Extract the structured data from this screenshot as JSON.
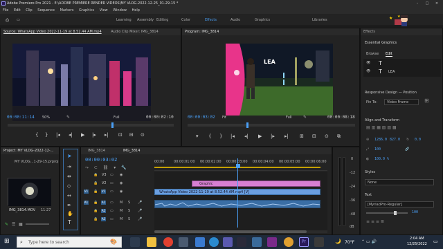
{
  "app": {
    "title": "Adobe Premiere Pro 2021 - E:\\ADOBE PREMIERE RENDER VIDEOS\\MY VLOG-2022-12-25_01-29-15 *"
  },
  "menu": [
    "File",
    "Edit",
    "Clip",
    "Sequence",
    "Markers",
    "Graphics",
    "View",
    "Window",
    "Help"
  ],
  "workspaces": [
    "Learning",
    "Assembly",
    "Editing",
    "Color",
    "Effects",
    "Audio",
    "Graphics",
    "Libraries"
  ],
  "active_workspace": "Effects",
  "source": {
    "tab": "Source: WhatsApp Video 2022-11-19 at 8.52.44 AM.mp4",
    "tab2": "Audio Clip Mixer: IMG_3814",
    "timecode": "00:00:11:14",
    "zoom": "50%",
    "quality": "Full",
    "duration": "00:00:02:10"
  },
  "program": {
    "tab": "Program: IMG_3814",
    "timecode": "00:00:03:02",
    "fit": "Fit",
    "quality": "Full",
    "duration": "00:00:08:18",
    "overlay_text": "LEA"
  },
  "project": {
    "tab": "Project: MY VLOG-2022-12-...",
    "file": "MY VLOG...1-29-15.prproj",
    "thumb_name": "IMG_3814.MOV",
    "thumb_dur": "11:27"
  },
  "timeline": {
    "tabs": [
      "IMG_3814",
      "IMG_3814"
    ],
    "timecode": "00:00:03:02",
    "ruler": [
      "00:00",
      "00:00:01:00",
      "00:00:02:00",
      "00:00:03:00",
      "00:00:04:00",
      "00:00:05:00",
      "00:00:06:00"
    ],
    "video_tracks": [
      "V3",
      "V2",
      "V1"
    ],
    "audio_tracks": [
      "A1",
      "A2",
      "A3"
    ],
    "track_letters": [
      "M",
      "S"
    ],
    "clips": {
      "graphic": "Graphic",
      "video": "WhatsApp Video 2022-11-19 at 8.52.44 AM.mp4 [V]"
    },
    "meter_labels": [
      "0",
      "-12",
      "-24",
      "-36",
      "-48",
      "dB"
    ]
  },
  "effects": {
    "tab": "Effects",
    "essential": "Essential Graphics",
    "browse": "Browse",
    "edit": "Edit",
    "layers": [
      "T",
      "LEA"
    ],
    "responsive": "Responsive Design — Position",
    "pin_to": "Pin To:",
    "pin_val": "Video Frame",
    "align": "Align and Transform",
    "pos_x": "1286.0",
    "pos_y": "827.0",
    "rot": "0.0",
    "scale": "100",
    "opacity": "100.0 %",
    "styles": "Styles",
    "styles_val": "None",
    "text": "Text",
    "font": "[MyriadPro-Regular]",
    "font_size": "100"
  },
  "taskbar": {
    "search_placeholder": "Type here to search",
    "weather": "70°F",
    "time": "2:04 AM",
    "date": "12/25/2022"
  },
  "colors": {
    "accent": "#4a9ff5",
    "graphic_clip": "#d77fd2",
    "video_clip": "#6b9fe0",
    "audio_clip": "#3a6ea5",
    "playhead": "#4a9ff5"
  }
}
